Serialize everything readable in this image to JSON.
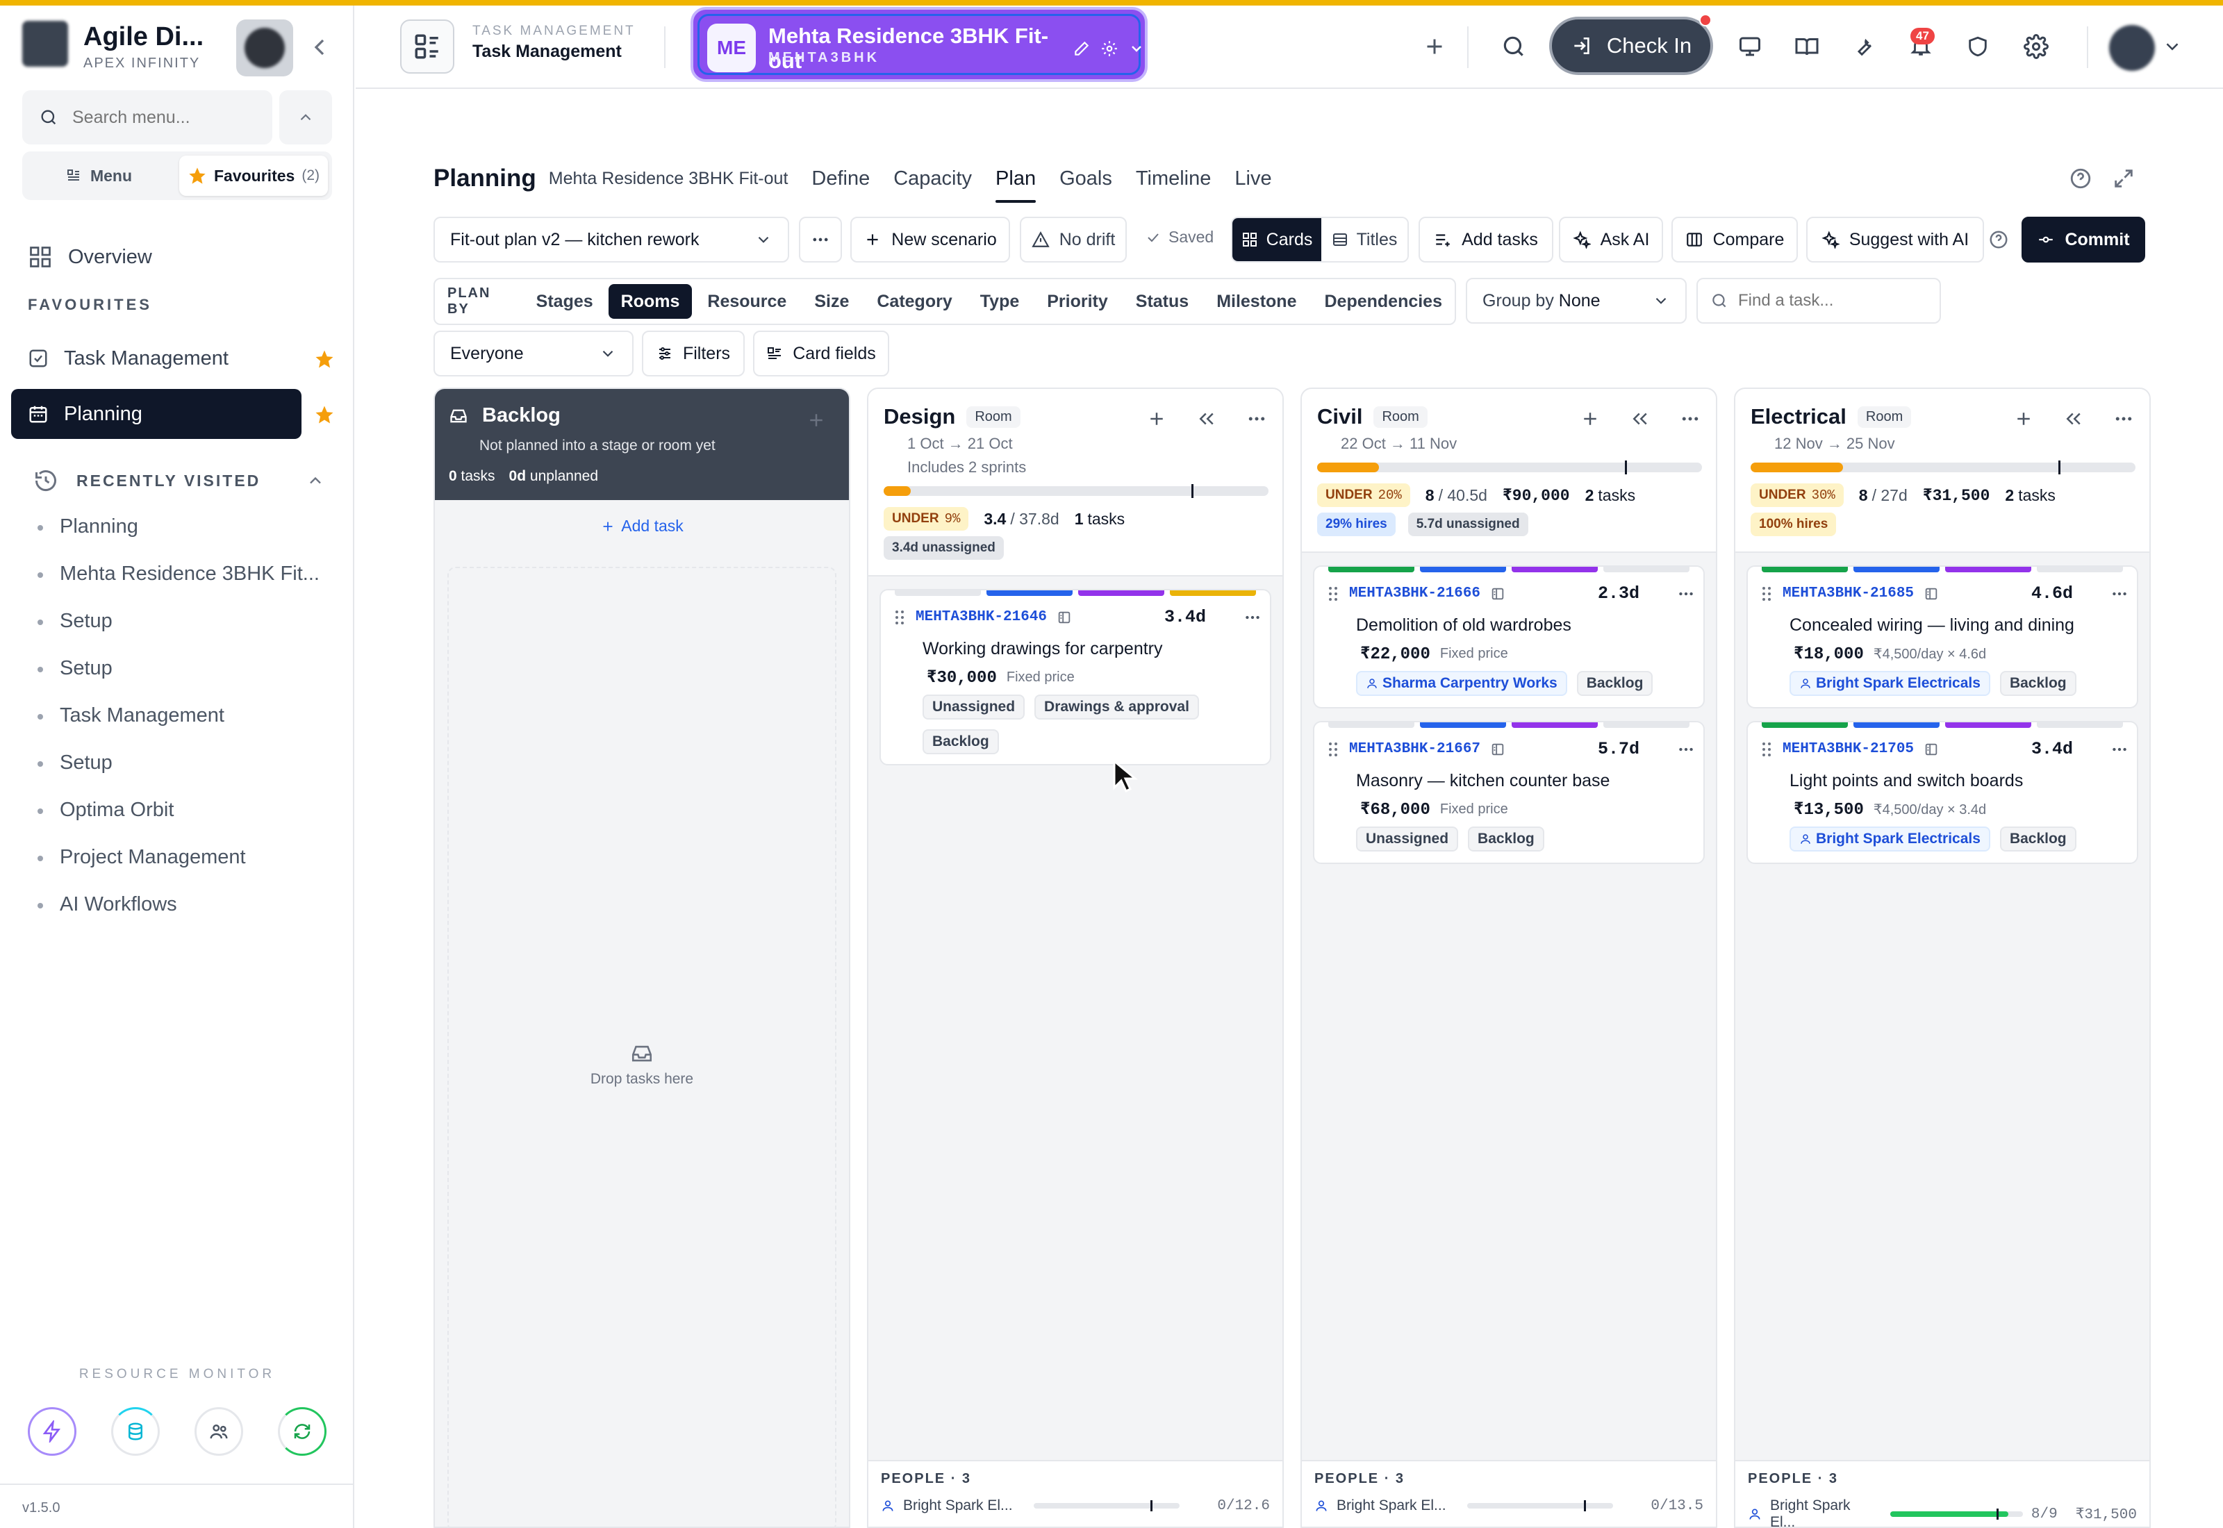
{
  "app": {
    "name": "Agile Di...",
    "org": "APEX INFINITY",
    "version": "v1.5.0"
  },
  "sidebar": {
    "search_placeholder": "Search menu...",
    "tab_menu": "Menu",
    "tab_favourites": "Favourites",
    "favourites_count": "(2)",
    "overview": "Overview",
    "favourites_heading": "FAVOURITES",
    "favourites": [
      {
        "label": "Task Management"
      },
      {
        "label": "Planning"
      }
    ],
    "recent_heading": "RECENTLY VISITED",
    "recent": [
      "Planning",
      "Mehta Residence 3BHK Fit...",
      "Setup",
      "Setup",
      "Task Management",
      "Setup",
      "Optima Orbit",
      "Project Management",
      "AI Workflows"
    ],
    "resource_monitor": "RESOURCE MONITOR"
  },
  "header": {
    "module_kicker": "TASK MANAGEMENT",
    "module_title": "Task Management",
    "project_initials": "ME",
    "project_name": "Mehta Residence 3BHK Fit-out",
    "project_code": "MEHTA3BHK",
    "check_in": "Check In",
    "notifications": "47"
  },
  "page": {
    "title": "Planning",
    "project": "Mehta Residence 3BHK Fit-out",
    "tabs": [
      "Define",
      "Capacity",
      "Plan",
      "Goals",
      "Timeline",
      "Live"
    ],
    "active_tab": "Plan"
  },
  "toolbar": {
    "scenario": "Fit-out plan v2 — kitchen rework",
    "new_scenario": "New scenario",
    "no_drift": "No drift",
    "saved": "Saved",
    "cards": "Cards",
    "titles": "Titles",
    "add_tasks": "Add tasks",
    "ask_ai": "Ask AI",
    "compare": "Compare",
    "suggest_ai": "Suggest with AI",
    "commit": "Commit"
  },
  "plan_by": {
    "label": "PLAN BY",
    "options": [
      "Stages",
      "Rooms",
      "Resource",
      "Size",
      "Category",
      "Type",
      "Priority",
      "Status",
      "Milestone",
      "Dependencies"
    ],
    "selected": "Rooms",
    "underline_colors": {
      "Stages": "#eab308",
      "Resource": "#16a34a",
      "Size": "#2563eb",
      "Category": "#9333ea"
    },
    "group_by_label": "Group by",
    "group_by_value": "None",
    "find_placeholder": "Find a task..."
  },
  "filters": {
    "audience": "Everyone",
    "filters": "Filters",
    "card_fields": "Card fields"
  },
  "backlog": {
    "name": "Backlog",
    "subtitle": "Not planned into a stage or room yet",
    "tasks_count": "0",
    "tasks_label": "tasks",
    "unplanned_count": "0d",
    "unplanned_label": "unplanned",
    "add_task": "Add task",
    "drop_hint": "Drop tasks here"
  },
  "columns": [
    {
      "name": "Design",
      "tag": "Room",
      "dates": "1 Oct → 21 Oct",
      "note": "Includes 2 sprints",
      "progress": 0.07,
      "under": "UNDER",
      "under_pct": "9%",
      "load": "3.4",
      "capacity": "/ 37.8d",
      "budget": "",
      "tasks": "1",
      "tasks_label": "tasks",
      "extra_chips": [
        {
          "text": "3.4d unassigned",
          "kind": "grey"
        }
      ],
      "cards": [
        {
          "code": "MEHTA3BHK-21646",
          "duration": "3.4d",
          "title": "Working drawings for carpentry",
          "price": "₹30,000",
          "price_note": "Fixed price",
          "tags": [
            {
              "text": "Unassigned",
              "kind": "plain"
            },
            {
              "text": "Drawings & approval",
              "kind": "plain"
            },
            {
              "text": "Backlog",
              "kind": "plain"
            }
          ],
          "stripes": [
            "#e5e7eb",
            "#2563eb",
            "#9333ea",
            "#eab308"
          ]
        }
      ],
      "people_label": "PEOPLE · 3",
      "people_name": "Bright Spark El...",
      "people_val": "0/12.6",
      "people_budget": "",
      "people_fill": 0
    },
    {
      "name": "Civil",
      "tag": "Room",
      "dates": "22 Oct → 11 Nov",
      "note": "",
      "progress": 0.16,
      "under": "UNDER",
      "under_pct": "20%",
      "load": "8",
      "capacity": "/ 40.5d",
      "budget": "₹90,000",
      "tasks": "2",
      "tasks_label": "tasks",
      "extra_chips": [
        {
          "text": "29% hires",
          "kind": "blue"
        },
        {
          "text": "5.7d unassigned",
          "kind": "grey"
        }
      ],
      "cards": [
        {
          "code": "MEHTA3BHK-21666",
          "duration": "2.3d",
          "title": "Demolition of old wardrobes",
          "price": "₹22,000",
          "price_note": "Fixed price",
          "tags": [
            {
              "text": "Sharma Carpentry Works",
              "kind": "res"
            },
            {
              "text": "Backlog",
              "kind": "plain"
            }
          ],
          "stripes": [
            "#16a34a",
            "#2563eb",
            "#9333ea",
            "#e5e7eb"
          ]
        },
        {
          "code": "MEHTA3BHK-21667",
          "duration": "5.7d",
          "title": "Masonry — kitchen counter base",
          "price": "₹68,000",
          "price_note": "Fixed price",
          "tags": [
            {
              "text": "Unassigned",
              "kind": "plain"
            },
            {
              "text": "Backlog",
              "kind": "plain"
            }
          ],
          "stripes": [
            "#e5e7eb",
            "#2563eb",
            "#9333ea",
            "#e5e7eb"
          ]
        }
      ],
      "people_label": "PEOPLE · 3",
      "people_name": "Bright Spark El...",
      "people_val": "0/13.5",
      "people_budget": "",
      "people_fill": 0
    },
    {
      "name": "Electrical",
      "tag": "Room",
      "dates": "12 Nov → 25 Nov",
      "note": "",
      "progress": 0.24,
      "under": "UNDER",
      "under_pct": "30%",
      "load": "8",
      "capacity": "/ 27d",
      "budget": "₹31,500",
      "tasks": "2",
      "tasks_label": "tasks",
      "extra_chips": [
        {
          "text": "100% hires",
          "kind": "under"
        }
      ],
      "cards": [
        {
          "code": "MEHTA3BHK-21685",
          "duration": "4.6d",
          "title": "Concealed wiring — living and dining",
          "price": "₹18,000",
          "price_note": "₹4,500/day × 4.6d",
          "tags": [
            {
              "text": "Bright Spark Electricals",
              "kind": "res"
            },
            {
              "text": "Backlog",
              "kind": "plain"
            }
          ],
          "stripes": [
            "#16a34a",
            "#2563eb",
            "#9333ea",
            "#e5e7eb"
          ]
        },
        {
          "code": "MEHTA3BHK-21705",
          "duration": "3.4d",
          "title": "Light points and switch boards",
          "price": "₹13,500",
          "price_note": "₹4,500/day × 3.4d",
          "tags": [
            {
              "text": "Bright Spark Electricals",
              "kind": "res"
            },
            {
              "text": "Backlog",
              "kind": "plain"
            }
          ],
          "stripes": [
            "#16a34a",
            "#2563eb",
            "#9333ea",
            "#e5e7eb"
          ]
        }
      ],
      "people_label": "PEOPLE · 3",
      "people_name": "Bright Spark El...",
      "people_val": "8/9",
      "people_budget": "₹31,500",
      "people_fill": 0.89
    }
  ]
}
